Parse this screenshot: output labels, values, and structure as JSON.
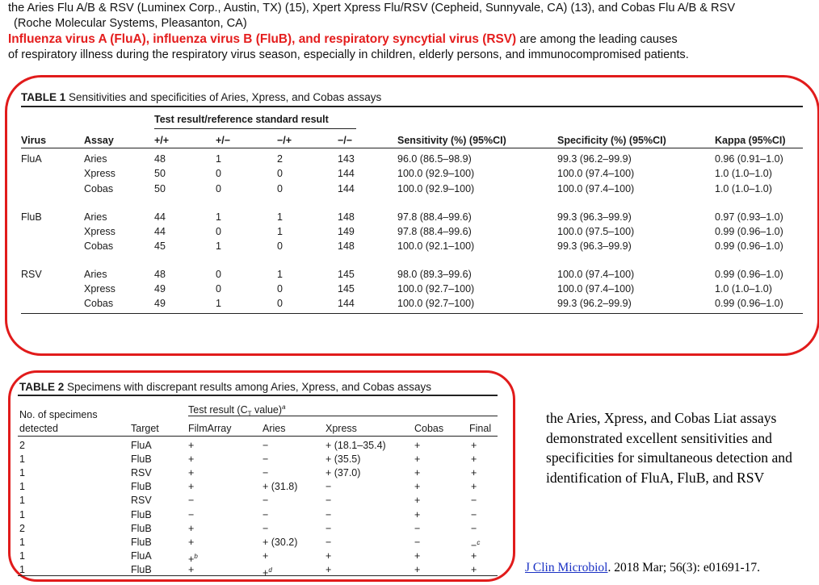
{
  "intro": {
    "line1": "the Aries Flu A/B & RSV (Luminex Corp., Austin, TX) (15), Xpert Xpress Flu/RSV (Cepheid, Sunnyvale, CA) (13), and Cobas Flu A/B & RSV",
    "line2": "(Roche Molecular Systems, Pleasanton, CA)",
    "highlight": "Influenza virus A (FluA), influenza virus B (FluB), and respiratory syncytial virus (RSV)",
    "rest": " are among the leading causes",
    "line4": "of respiratory illness during the respiratory virus season, especially in children, elderly persons, and immunocompromised patients."
  },
  "table1": {
    "label": "TABLE 1",
    "caption": " Sensitivities and specificities of Aries, Xpress, and Cobas assays",
    "group_header": "Test result/reference standard result",
    "headers": [
      "Virus",
      "Assay",
      "+/+",
      "+/−",
      "−/+",
      "−/−",
      "Sensitivity (%) (95%CI)",
      "Specificity (%) (95%CI)",
      "Kappa (95%CI)"
    ],
    "rows": [
      [
        "FluA",
        "Aries",
        "48",
        "1",
        "2",
        "143",
        "96.0 (86.5–98.9)",
        "99.3 (96.2–99.9)",
        "0.96 (0.91–1.0)"
      ],
      [
        "",
        "Xpress",
        "50",
        "0",
        "0",
        "144",
        "100.0 (92.9–100)",
        "100.0 (97.4–100)",
        "1.0 (1.0–1.0)"
      ],
      [
        "",
        "Cobas",
        "50",
        "0",
        "0",
        "144",
        "100.0 (92.9–100)",
        "100.0 (97.4–100)",
        "1.0 (1.0–1.0)"
      ],
      [
        "FluB",
        "Aries",
        "44",
        "1",
        "1",
        "148",
        "97.8 (88.4–99.6)",
        "99.3 (96.3–99.9)",
        "0.97 (0.93–1.0)"
      ],
      [
        "",
        "Xpress",
        "44",
        "0",
        "1",
        "149",
        "97.8 (88.4–99.6)",
        "100.0 (97.5–100)",
        "0.99 (0.96–1.0)"
      ],
      [
        "",
        "Cobas",
        "45",
        "1",
        "0",
        "148",
        "100.0 (92.1–100)",
        "99.3 (96.3–99.9)",
        "0.99 (0.96–1.0)"
      ],
      [
        "RSV",
        "Aries",
        "48",
        "0",
        "1",
        "145",
        "98.0 (89.3–99.6)",
        "100.0 (97.4–100)",
        "0.99 (0.96–1.0)"
      ],
      [
        "",
        "Xpress",
        "49",
        "0",
        "0",
        "145",
        "100.0 (92.7–100)",
        "100.0 (97.4–100)",
        "1.0 (1.0–1.0)"
      ],
      [
        "",
        "Cobas",
        "49",
        "1",
        "0",
        "144",
        "100.0 (92.7–100)",
        "99.3 (96.2–99.9)",
        "0.99 (0.96–1.0)"
      ]
    ]
  },
  "table2": {
    "label": "TABLE 2",
    "caption": " Specimens with discrepant results among Aries, Xpress, and Cobas assays",
    "header_top_left": "No. of specimens",
    "header_bottom_left": "detected",
    "group_header": "Test result (C",
    "group_header_sub": "T",
    "group_header_tail": " value)",
    "group_header_sup": "a",
    "headers": [
      "Target",
      "FilmArray",
      "Aries",
      "Xpress",
      "Cobas",
      "Final"
    ],
    "rows": [
      [
        "2",
        "FluA",
        "+",
        "−",
        "+ (18.1–35.4)",
        "+",
        "+"
      ],
      [
        "1",
        "FluB",
        "+",
        "−",
        "+ (35.5)",
        "+",
        "+"
      ],
      [
        "1",
        "RSV",
        "+",
        "−",
        "+ (37.0)",
        "+",
        "+"
      ],
      [
        "1",
        "FluB",
        "+",
        "+ (31.8)",
        "−",
        "+",
        "+"
      ],
      [
        "1",
        "RSV",
        "−",
        "−",
        "−",
        "+",
        "−"
      ],
      [
        "1",
        "FluB",
        "−",
        "−",
        "−",
        "+",
        "−"
      ],
      [
        "2",
        "FluB",
        "+",
        "−",
        "−",
        "−",
        "−"
      ],
      [
        "1",
        "FluB",
        "+",
        "+ (30.2)",
        "−",
        "−",
        "−"
      ],
      [
        "1",
        "FluA",
        "+",
        "+",
        "+",
        "+",
        "+"
      ],
      [
        "1",
        "FluB",
        "+",
        "+",
        "+",
        "+",
        "+"
      ]
    ],
    "sups": {
      "r7_final": "c",
      "r8_filmarray": "b",
      "r9_aries": "d"
    }
  },
  "sidebar_text": "the Aries, Xpress, and Cobas Liat assays demonstrated excellent sensitivities and specificities for simultaneous detection and identification of FluA, FluB, and RSV",
  "citation": {
    "journal": "J Clin Microbiol",
    "rest": ". 2018 Mar; 56(3): e01691-17."
  },
  "colors": {
    "highlight_red": "#e41d1d",
    "annotation_outline": "#e11b1b",
    "link_blue": "#1a31c4"
  }
}
